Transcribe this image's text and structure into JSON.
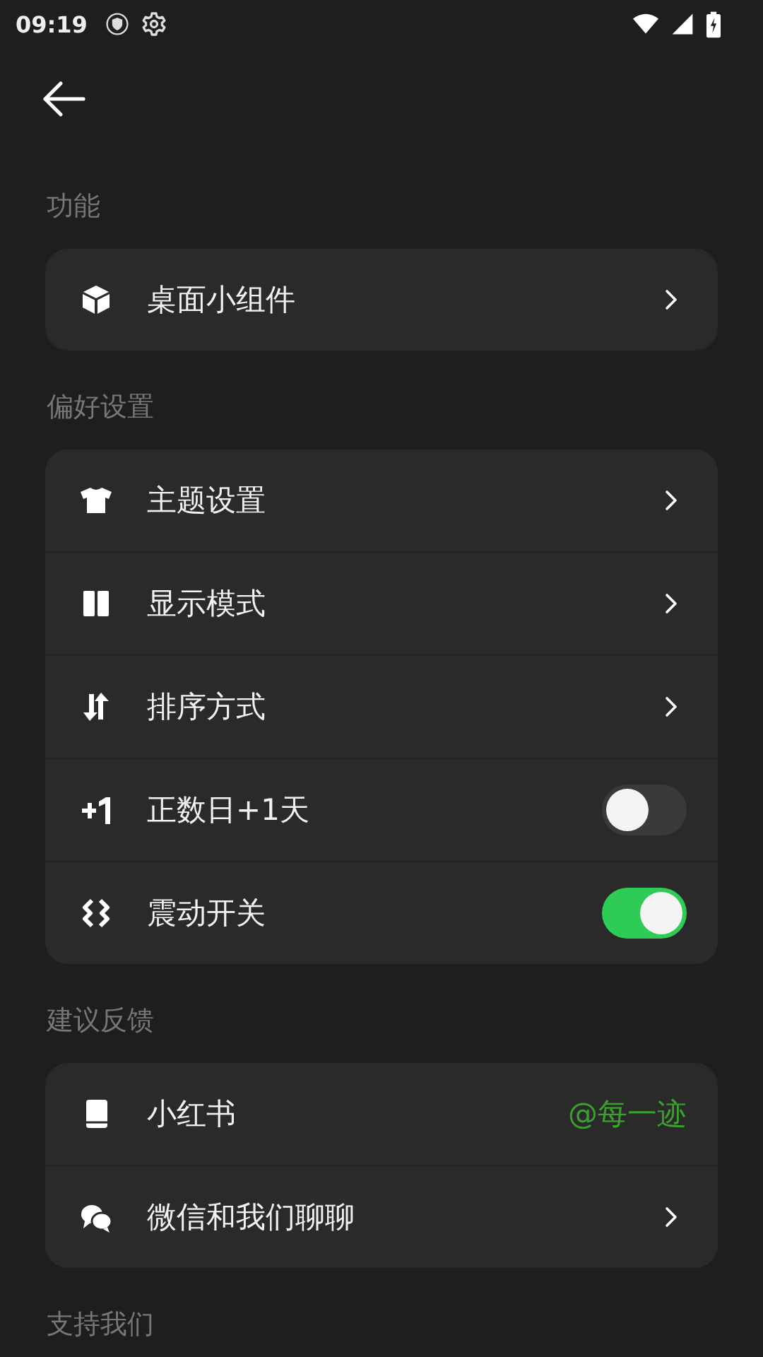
{
  "status_bar": {
    "time": "09:19"
  },
  "sections": [
    {
      "title": "功能",
      "items": [
        {
          "kind": "link",
          "label": "桌面小组件"
        }
      ]
    },
    {
      "title": "偏好设置",
      "items": [
        {
          "kind": "link",
          "label": "主题设置"
        },
        {
          "kind": "link",
          "label": "显示模式"
        },
        {
          "kind": "link",
          "label": "排序方式"
        },
        {
          "kind": "toggle",
          "label": "正数日+1天",
          "on": false
        },
        {
          "kind": "toggle",
          "label": "震动开关",
          "on": true
        }
      ]
    },
    {
      "title": "建议反馈",
      "items": [
        {
          "kind": "value",
          "label": "小红书",
          "value": "@每一迹"
        },
        {
          "kind": "link",
          "label": "微信和我们聊聊"
        }
      ]
    },
    {
      "title": "支持我们"
    }
  ]
}
